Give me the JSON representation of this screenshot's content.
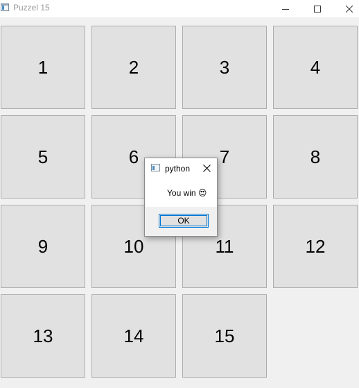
{
  "window": {
    "title": "Puzzel 15",
    "icons": {
      "app": "window-app-icon",
      "minimize": "minimize-icon",
      "maximize": "maximize-icon",
      "close": "close-icon"
    }
  },
  "board": {
    "tiles": [
      "1",
      "2",
      "3",
      "4",
      "5",
      "6",
      "7",
      "8",
      "9",
      "10",
      "11",
      "12",
      "13",
      "14",
      "15",
      ""
    ]
  },
  "dialog": {
    "title": "python",
    "message": "You win 😍",
    "ok_label": "OK",
    "icons": {
      "app": "window-app-icon",
      "close": "close-icon"
    },
    "accent_color": "#0078d7"
  },
  "colors": {
    "tile_bg": "#e1e1e1",
    "tile_border": "#adadad",
    "window_bg": "#f0f0f0"
  }
}
